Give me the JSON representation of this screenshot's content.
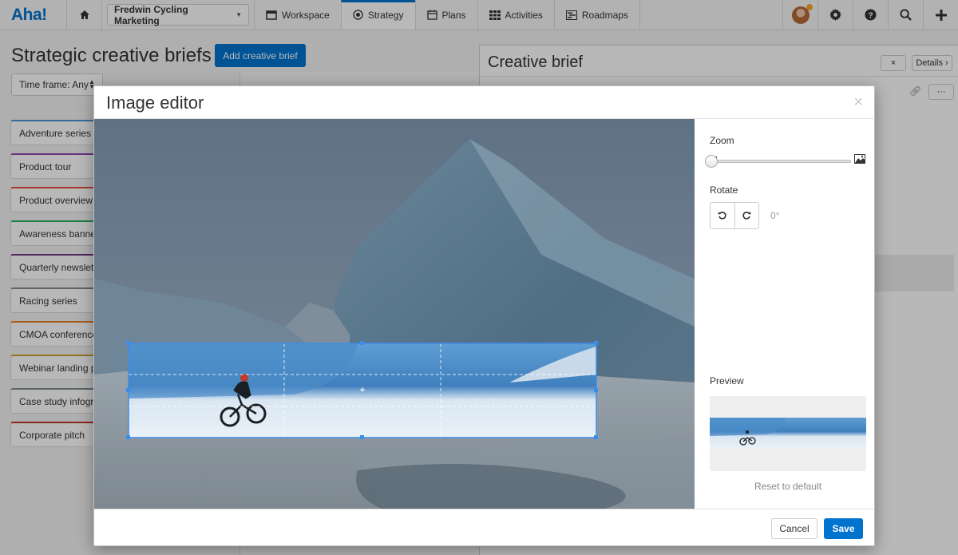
{
  "nav": {
    "logo": "Aha!",
    "workspace": "Fredwin Cycling Marketing",
    "tabs": [
      {
        "label": "Workspace",
        "icon": "window-icon"
      },
      {
        "label": "Strategy",
        "icon": "target-icon"
      },
      {
        "label": "Plans",
        "icon": "calendar-icon"
      },
      {
        "label": "Activities",
        "icon": "grid-icon"
      },
      {
        "label": "Roadmaps",
        "icon": "roadmap-icon"
      }
    ],
    "active_tab": "Strategy",
    "accent": "#0073cf",
    "notification_color": "#f5a623"
  },
  "page": {
    "title": "Strategic creative briefs",
    "add_button": "Add creative brief",
    "timeframe": "Time frame: Any",
    "items": [
      {
        "label": "Adventure series",
        "color": "#4a90d9"
      },
      {
        "label": "Product tour",
        "color": "#8e44ad"
      },
      {
        "label": "Product overview",
        "color": "#e74c3c"
      },
      {
        "label": "Awareness banne",
        "color": "#27ae60"
      },
      {
        "label": "Quarterly newslet",
        "color": "#6c3483"
      },
      {
        "label": "Racing series",
        "color": "#7f8c8d"
      },
      {
        "label": "CMOA conference",
        "color": "#e67e22"
      },
      {
        "label": "Webinar landing p",
        "color": "#c9a227"
      },
      {
        "label": "Case study infogra",
        "color": "#7f8c8d"
      },
      {
        "label": "Corporate pitch",
        "color": "#c0392b"
      }
    ]
  },
  "brief": {
    "title": "Creative brief",
    "details": "Details",
    "close": "×",
    "more": "···"
  },
  "modal": {
    "title": "Image editor",
    "close": "×",
    "zoom_label": "Zoom",
    "zoom_value": 0.0,
    "rotate_label": "Rotate",
    "rotate_value": "0°",
    "preview_label": "Preview",
    "reset": "Reset to default",
    "cancel": "Cancel",
    "save": "Save"
  }
}
